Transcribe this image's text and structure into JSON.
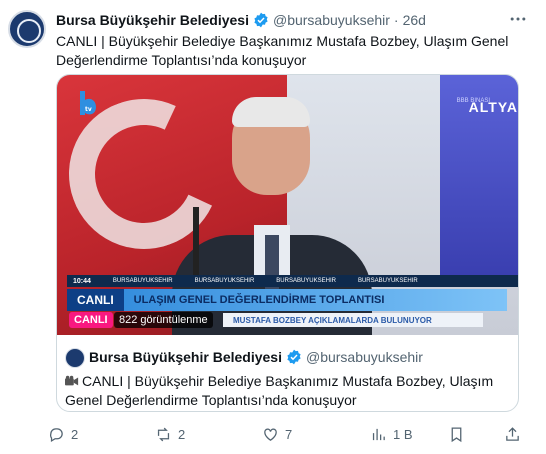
{
  "tweet": {
    "author_name": "Bursa Büyükşehir Belediyesi",
    "handle": "@bursabuyuksehir",
    "separator": "·",
    "time": "26d",
    "text": "CANLI | Büyükşehir Belediye Başkanımız Mustafa Bozbey, Ulaşım Genel Değerlendirme Toplantısı’nda konuşuyor"
  },
  "video": {
    "live_badge": "CANLI",
    "views": "822 görüntülenme",
    "overlay": {
      "clock": "10:44",
      "social": [
        "BURSABUYUKSEHIR",
        "BURSABUYUKSEHIR",
        "BURSABUYUKSEHIR",
        "BURSABUYUKSEHIR"
      ],
      "tag": "CANLI",
      "title": "ULAŞIM GENEL DEĞERLENDİRME TOPLANTISI",
      "subtitle": "MUSTAFA BOZBEY AÇIKLAMALARDA BULUNUYOR",
      "panel_text": "ALTYA",
      "panel_small": "BBB BINASI"
    }
  },
  "quote": {
    "author_name": "Bursa Büyükşehir Belediyesi",
    "handle": "@bursabuyuksehir",
    "text": "CANLI | Büyükşehir Belediye Başkanımız Mustafa Bozbey, Ulaşım Genel Değerlendirme Toplantısı’nda konuşuyor"
  },
  "actions": {
    "replies": "2",
    "reposts": "2",
    "likes": "7",
    "views": "1 B"
  },
  "colors": {
    "verified": "#1d9bf0",
    "live": "#f91880",
    "muted": "#536471"
  }
}
